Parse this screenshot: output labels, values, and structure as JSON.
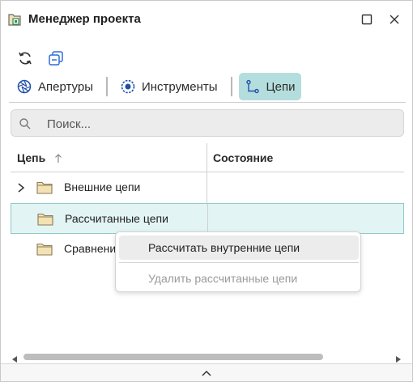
{
  "window": {
    "title": "Менеджер проекта"
  },
  "toolbar": {
    "refresh_icon": "refresh-icon",
    "collapse_all_icon": "collapse-all-icon"
  },
  "tabs": [
    {
      "label": "Апертуры",
      "icon": "aperture-icon",
      "active": false
    },
    {
      "label": "Инструменты",
      "icon": "tool-icon",
      "active": false
    },
    {
      "label": "Цепи",
      "icon": "net-icon",
      "active": true
    }
  ],
  "search": {
    "placeholder": "Поиск...",
    "value": ""
  },
  "table": {
    "columns": [
      "Цепь",
      "Состояние"
    ],
    "sort": "ascending",
    "rows": [
      {
        "label": "Внешние цепи",
        "expandable": true,
        "selected": false
      },
      {
        "label": "Рассчитанные цепи",
        "expandable": false,
        "selected": true
      },
      {
        "label": "Сравнени",
        "expandable": false,
        "selected": false
      }
    ]
  },
  "context_menu": {
    "items": [
      {
        "label": "Рассчитать внутренние цепи",
        "enabled": true
      },
      {
        "label": "Удалить рассчитанные цепи",
        "enabled": false
      }
    ]
  },
  "colors": {
    "accent": "#b4dedd",
    "selection": "#e3f4f4",
    "folder": "#f3e2b3"
  }
}
